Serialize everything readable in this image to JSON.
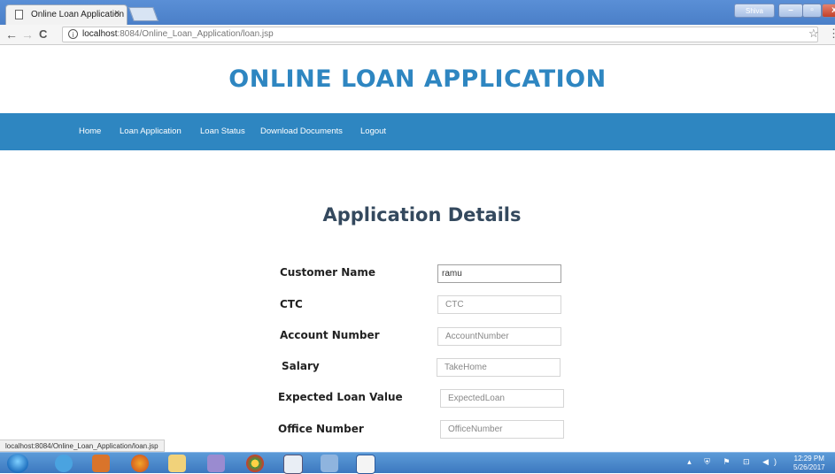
{
  "browser": {
    "tab_title": "Online Loan Application",
    "tab_close": "×",
    "window_user": "Shiva",
    "url_host": "localhost",
    "url_rest": ":8084/Online_Loan_Application/loan.jsp",
    "status_url": "localhost:8084/Online_Loan_Application/loan.jsp",
    "nav_back": "←",
    "nav_forward": "→",
    "nav_reload": "C",
    "star_icon": "☆",
    "menu_icon": "⋮"
  },
  "header": {
    "title": "ONLINE LOAN APPLICATION"
  },
  "navbar": {
    "items": [
      {
        "label": "Home"
      },
      {
        "label": "Loan Application"
      },
      {
        "label": "Loan Status"
      },
      {
        "label": "Download Documents"
      },
      {
        "label": "Logout"
      }
    ]
  },
  "form": {
    "title": "Application Details",
    "fields": [
      {
        "label": "Customer Name",
        "value": "ramu",
        "placeholder": ""
      },
      {
        "label": "CTC",
        "value": "",
        "placeholder": "CTC"
      },
      {
        "label": "Account Number",
        "value": "",
        "placeholder": "AccountNumber"
      },
      {
        "label": "Salary",
        "value": "",
        "placeholder": "TakeHome"
      },
      {
        "label": "Expected Loan Value",
        "value": "",
        "placeholder": "ExpectedLoan"
      },
      {
        "label": "Office Number",
        "value": "",
        "placeholder": "OfficeNumber"
      }
    ]
  },
  "taskbar": {
    "time": "12:29 PM",
    "date": "5/26/2017"
  },
  "colors": {
    "accent": "#2e86c1",
    "heading": "#34495e"
  }
}
